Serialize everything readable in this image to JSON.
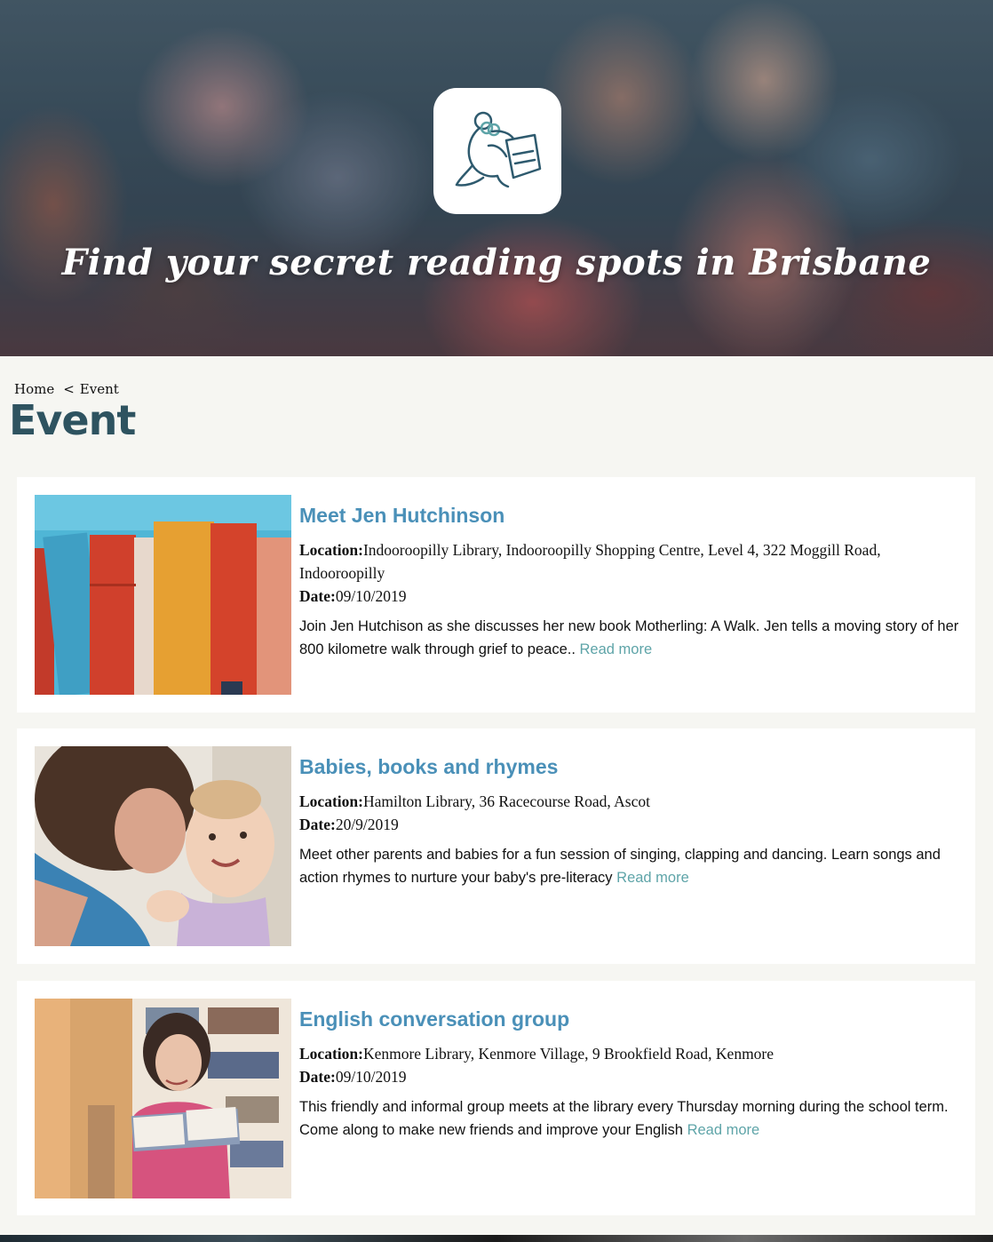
{
  "hero": {
    "tagline": "Find your secret reading spots in Brisbane"
  },
  "breadcrumb": {
    "home": "Home",
    "separator": "<",
    "current": "Event"
  },
  "page_title": "Event",
  "events": [
    {
      "title": "Meet Jen Hutchinson",
      "location_label": "Location:",
      "location": "Indooroopilly Library, Indooroopilly Shopping Centre, Level 4, 322 Moggill Road, Indooroopilly",
      "date_label": "Date:",
      "date": "09/10/2019",
      "description": "Join Jen Hutchison as she discusses her new book Motherling: A Walk. Jen tells a moving story of her 800 kilometre walk through grief to peace..",
      "read_more": "Read more",
      "image": "books-on-shelf"
    },
    {
      "title": "Babies, books and rhymes",
      "location_label": "Location:",
      "location": "Hamilton Library, 36 Racecourse Road, Ascot",
      "date_label": "Date:",
      "date": "20/9/2019",
      "description": "Meet other parents and babies for a fun session of singing, clapping and dancing. Learn songs and action rhymes to nurture your baby's pre-literacy",
      "read_more": "Read more",
      "image": "mother-and-baby"
    },
    {
      "title": "English conversation group",
      "location_label": "Location:",
      "location": "Kenmore Library, Kenmore Village, 9 Brookfield Road, Kenmore",
      "date_label": "Date:",
      "date": "09/10/2019",
      "description": "This friendly and informal group meets at the library every Thursday morning during the school term. Come along to make new friends and improve your English",
      "read_more": "Read more",
      "image": "woman-reading-in-library"
    }
  ],
  "colors": {
    "title_blue": "#4a90b8",
    "link_teal": "#5ea4a8",
    "heading_dark": "#2e5360",
    "background": "#f6f6f2"
  }
}
